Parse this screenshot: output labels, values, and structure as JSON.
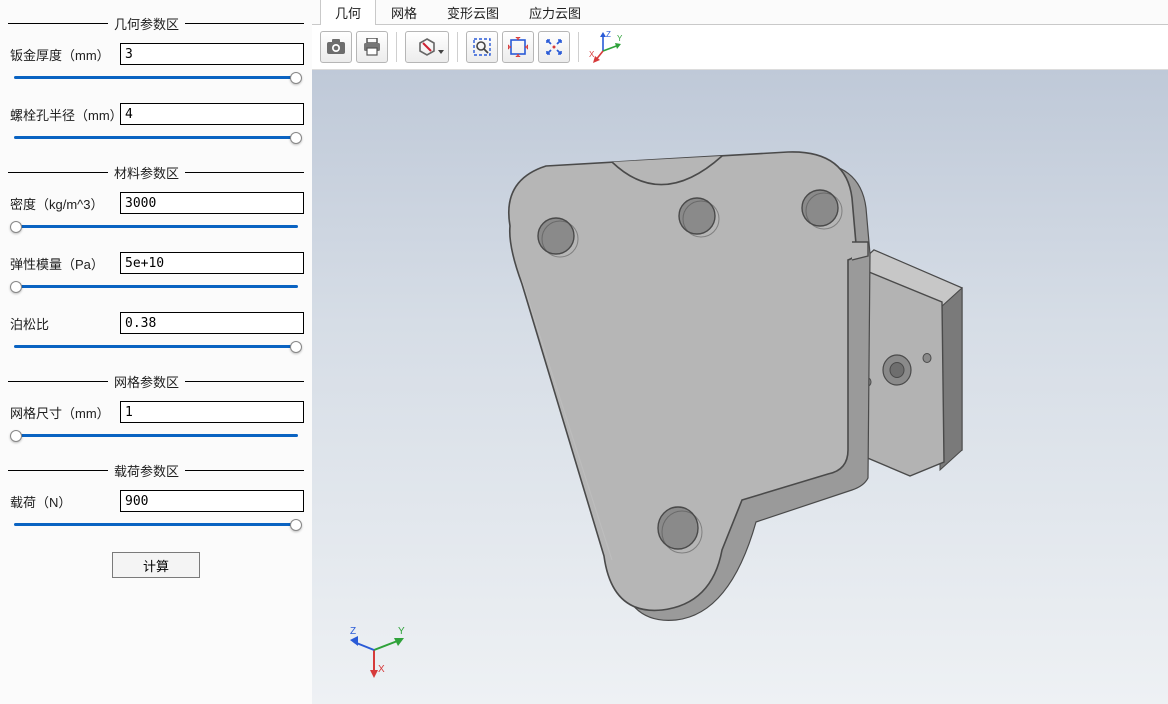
{
  "sections": {
    "geometry": {
      "title": "几何参数区"
    },
    "material": {
      "title": "材料参数区"
    },
    "mesh": {
      "title": "网格参数区"
    },
    "load": {
      "title": "载荷参数区"
    }
  },
  "params": {
    "thickness": {
      "label": "钣金厚度（mm）",
      "value": "3",
      "sliderPos": 100
    },
    "boltRadius": {
      "label": "螺栓孔半径（mm）",
      "value": "4",
      "sliderPos": 100
    },
    "density": {
      "label": "密度（kg/m^3）",
      "value": "3000",
      "sliderPos": 0
    },
    "youngs": {
      "label": "弹性模量（Pa）",
      "value": "5e+10",
      "sliderPos": 0
    },
    "poisson": {
      "label": "泊松比",
      "value": "0.38",
      "sliderPos": 100
    },
    "meshSize": {
      "label": "网格尺寸（mm）",
      "value": "1",
      "sliderPos": 0
    },
    "loadN": {
      "label": "载荷（N）",
      "value": "900",
      "sliderPos": 100
    }
  },
  "buttons": {
    "compute": "计算"
  },
  "tabs": [
    {
      "id": "geometry",
      "label": "几何",
      "active": true
    },
    {
      "id": "mesh",
      "label": "网格",
      "active": false
    },
    {
      "id": "deform",
      "label": "变形云图",
      "active": false
    },
    {
      "id": "stress",
      "label": "应力云图",
      "active": false
    }
  ],
  "toolbar": {
    "camera": "camera-icon",
    "print": "print-icon",
    "cancel": "cancel-icon",
    "zoomBox": "zoom-box-icon",
    "fitAll": "fit-all-icon",
    "zoomSel": "zoom-to-selection-icon",
    "axes": "axis-orientation-icon"
  },
  "triad": {
    "labels": {
      "x": "X",
      "y": "Y",
      "z": "Z"
    }
  },
  "colors": {
    "sliderTrack": "#0a63c2",
    "partFace": "#b0b0b0",
    "partEdge": "#4a4a4a",
    "triadX": "#d63a3a",
    "triadY": "#2fa23a",
    "triadZ": "#2a5bd7"
  }
}
